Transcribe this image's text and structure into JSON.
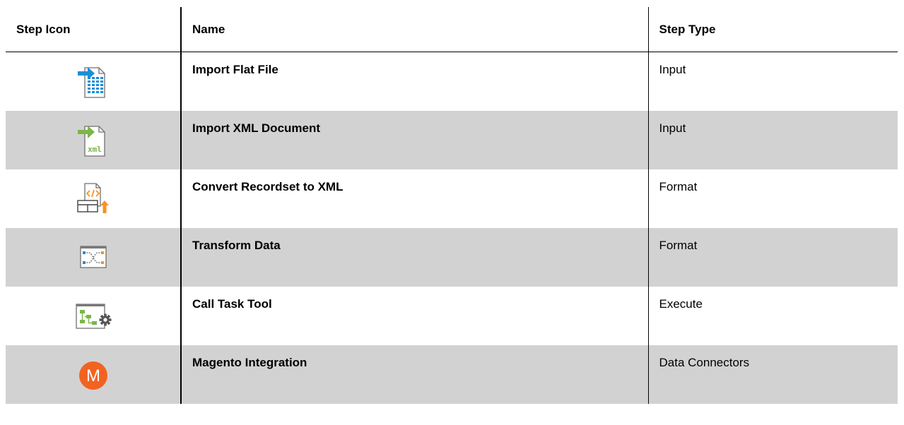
{
  "headers": {
    "icon": "Step Icon",
    "name": "Name",
    "type": "Step Type"
  },
  "rows": [
    {
      "icon": "import-flat-file-icon",
      "name": "Import Flat File",
      "type": "Input"
    },
    {
      "icon": "import-xml-document-icon",
      "name": "Import XML Document",
      "type": "Input"
    },
    {
      "icon": "convert-recordset-to-xml-icon",
      "name": "Convert Recordset to XML",
      "type": "Format"
    },
    {
      "icon": "transform-data-icon",
      "name": "Transform Data",
      "type": "Format"
    },
    {
      "icon": "call-task-tool-icon",
      "name": "Call Task Tool",
      "type": "Execute"
    },
    {
      "icon": "magento-icon",
      "name": "Magento Integration",
      "type": "Data Connectors"
    }
  ],
  "icon_text": {
    "xml": "xml",
    "magento": "M"
  },
  "colors": {
    "shade": "#d3d2d3",
    "blue": "#1b8fd6",
    "green": "#7ab648",
    "orange": "#f7931e",
    "magento": "#f26322"
  }
}
